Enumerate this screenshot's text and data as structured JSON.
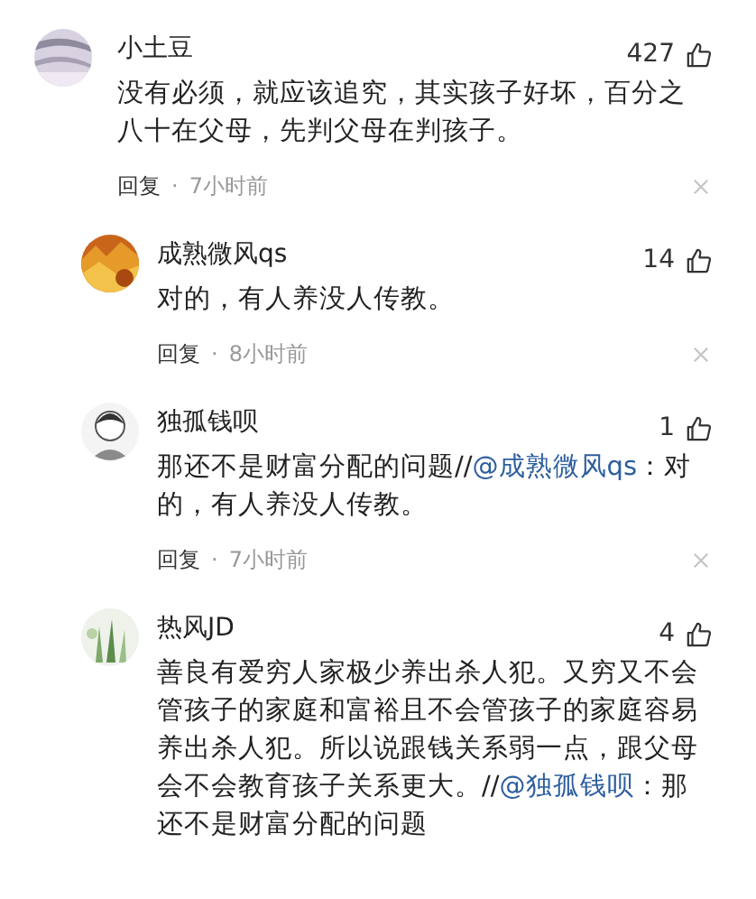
{
  "comments": [
    {
      "name": "小土豆",
      "likes": "427",
      "body": "没有必须，就应该追究，其实孩子好坏，百分之八十在父母，先判父母在判孩子。",
      "reply_label": "回复",
      "separator": "·",
      "time": "7小时前",
      "replies": [
        {
          "name": "成熟微风qs",
          "likes": "14",
          "body": "对的，有人养没人传教。",
          "reply_label": "回复",
          "separator": "·",
          "time": "8小时前"
        },
        {
          "name": "独孤钱呗",
          "likes": "1",
          "body": "那还不是财富分配的问题//",
          "mention": "@成熟微风qs",
          "body_rest": "：对的，有人养没人传教。",
          "reply_label": "回复",
          "separator": "·",
          "time": "7小时前"
        },
        {
          "name": "热风JD",
          "likes": "4",
          "body": "善良有爱穷人家极少养出杀人犯。又穷又不会管孩子的家庭和富裕且不会管孩子的家庭容易养出杀人犯。所以说跟钱关系弱一点，跟父母会不会教育孩子关系更大。//",
          "mention": "@独孤钱呗",
          "body_rest": "：那还不是财富分配的问题"
        }
      ]
    }
  ]
}
